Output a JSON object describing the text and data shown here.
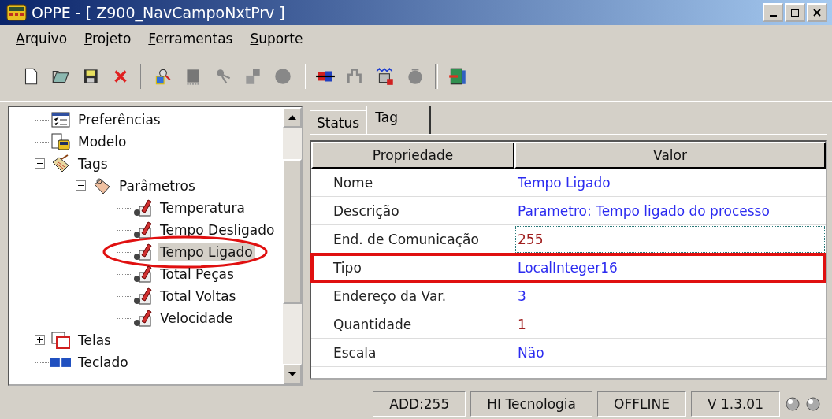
{
  "window": {
    "title": "OPPE - [ Z900_NavCampoNxtPrv ]"
  },
  "menu": [
    "Arquivo",
    "Projeto",
    "Ferramentas",
    "Suporte"
  ],
  "tree": [
    {
      "label": "Preferências",
      "kind": "preferences",
      "selected": false
    },
    {
      "label": "Modelo",
      "kind": "model",
      "selected": false
    },
    {
      "label": "Tags",
      "kind": "tags",
      "selected": false,
      "expanded": true,
      "children": [
        {
          "label": "Parâmetros",
          "kind": "folder",
          "selected": false,
          "expanded": true,
          "children": [
            {
              "label": "Temperatura",
              "kind": "tag",
              "selected": false
            },
            {
              "label": "Tempo Desligado",
              "kind": "tag",
              "selected": false
            },
            {
              "label": "Tempo Ligado",
              "kind": "tag",
              "selected": true,
              "annotated": true
            },
            {
              "label": "Total Peças",
              "kind": "tag",
              "selected": false
            },
            {
              "label": "Total Voltas",
              "kind": "tag",
              "selected": false
            },
            {
              "label": "Velocidade",
              "kind": "tag",
              "selected": false
            }
          ]
        }
      ]
    },
    {
      "label": "Telas",
      "kind": "screens",
      "selected": false,
      "expanded": false
    },
    {
      "label": "Teclado",
      "kind": "keyboard",
      "selected": false
    }
  ],
  "tabs": [
    {
      "label": "Status",
      "selected": false
    },
    {
      "label": "Tag",
      "selected": true
    }
  ],
  "table": {
    "columns": [
      "Propriedade",
      "Valor"
    ],
    "rows": [
      {
        "property": "Nome",
        "value": "Tempo Ligado",
        "color": "#2b2bf0",
        "focused": false
      },
      {
        "property": "Descrição",
        "value": "Parametro: Tempo ligado do processo",
        "color": "#2b2bf0",
        "focused": false
      },
      {
        "property": "End. de Comunicação",
        "value": "255",
        "color": "#a02020",
        "focused": true
      },
      {
        "property": "Tipo",
        "value": "LocalInteger16",
        "color": "#2b2bf0",
        "focused": false,
        "annotated": true
      },
      {
        "property": "Endereço da Var.",
        "value": "3",
        "color": "#2b2bf0",
        "focused": false
      },
      {
        "property": "Quantidade",
        "value": "1",
        "color": "#a02020",
        "focused": false
      },
      {
        "property": "Escala",
        "value": "Não",
        "color": "#2b2bf0",
        "focused": false
      }
    ]
  },
  "status_bar": [
    "ADD:255",
    "HI Tecnologia",
    "OFFLINE",
    "V 1.3.01"
  ]
}
